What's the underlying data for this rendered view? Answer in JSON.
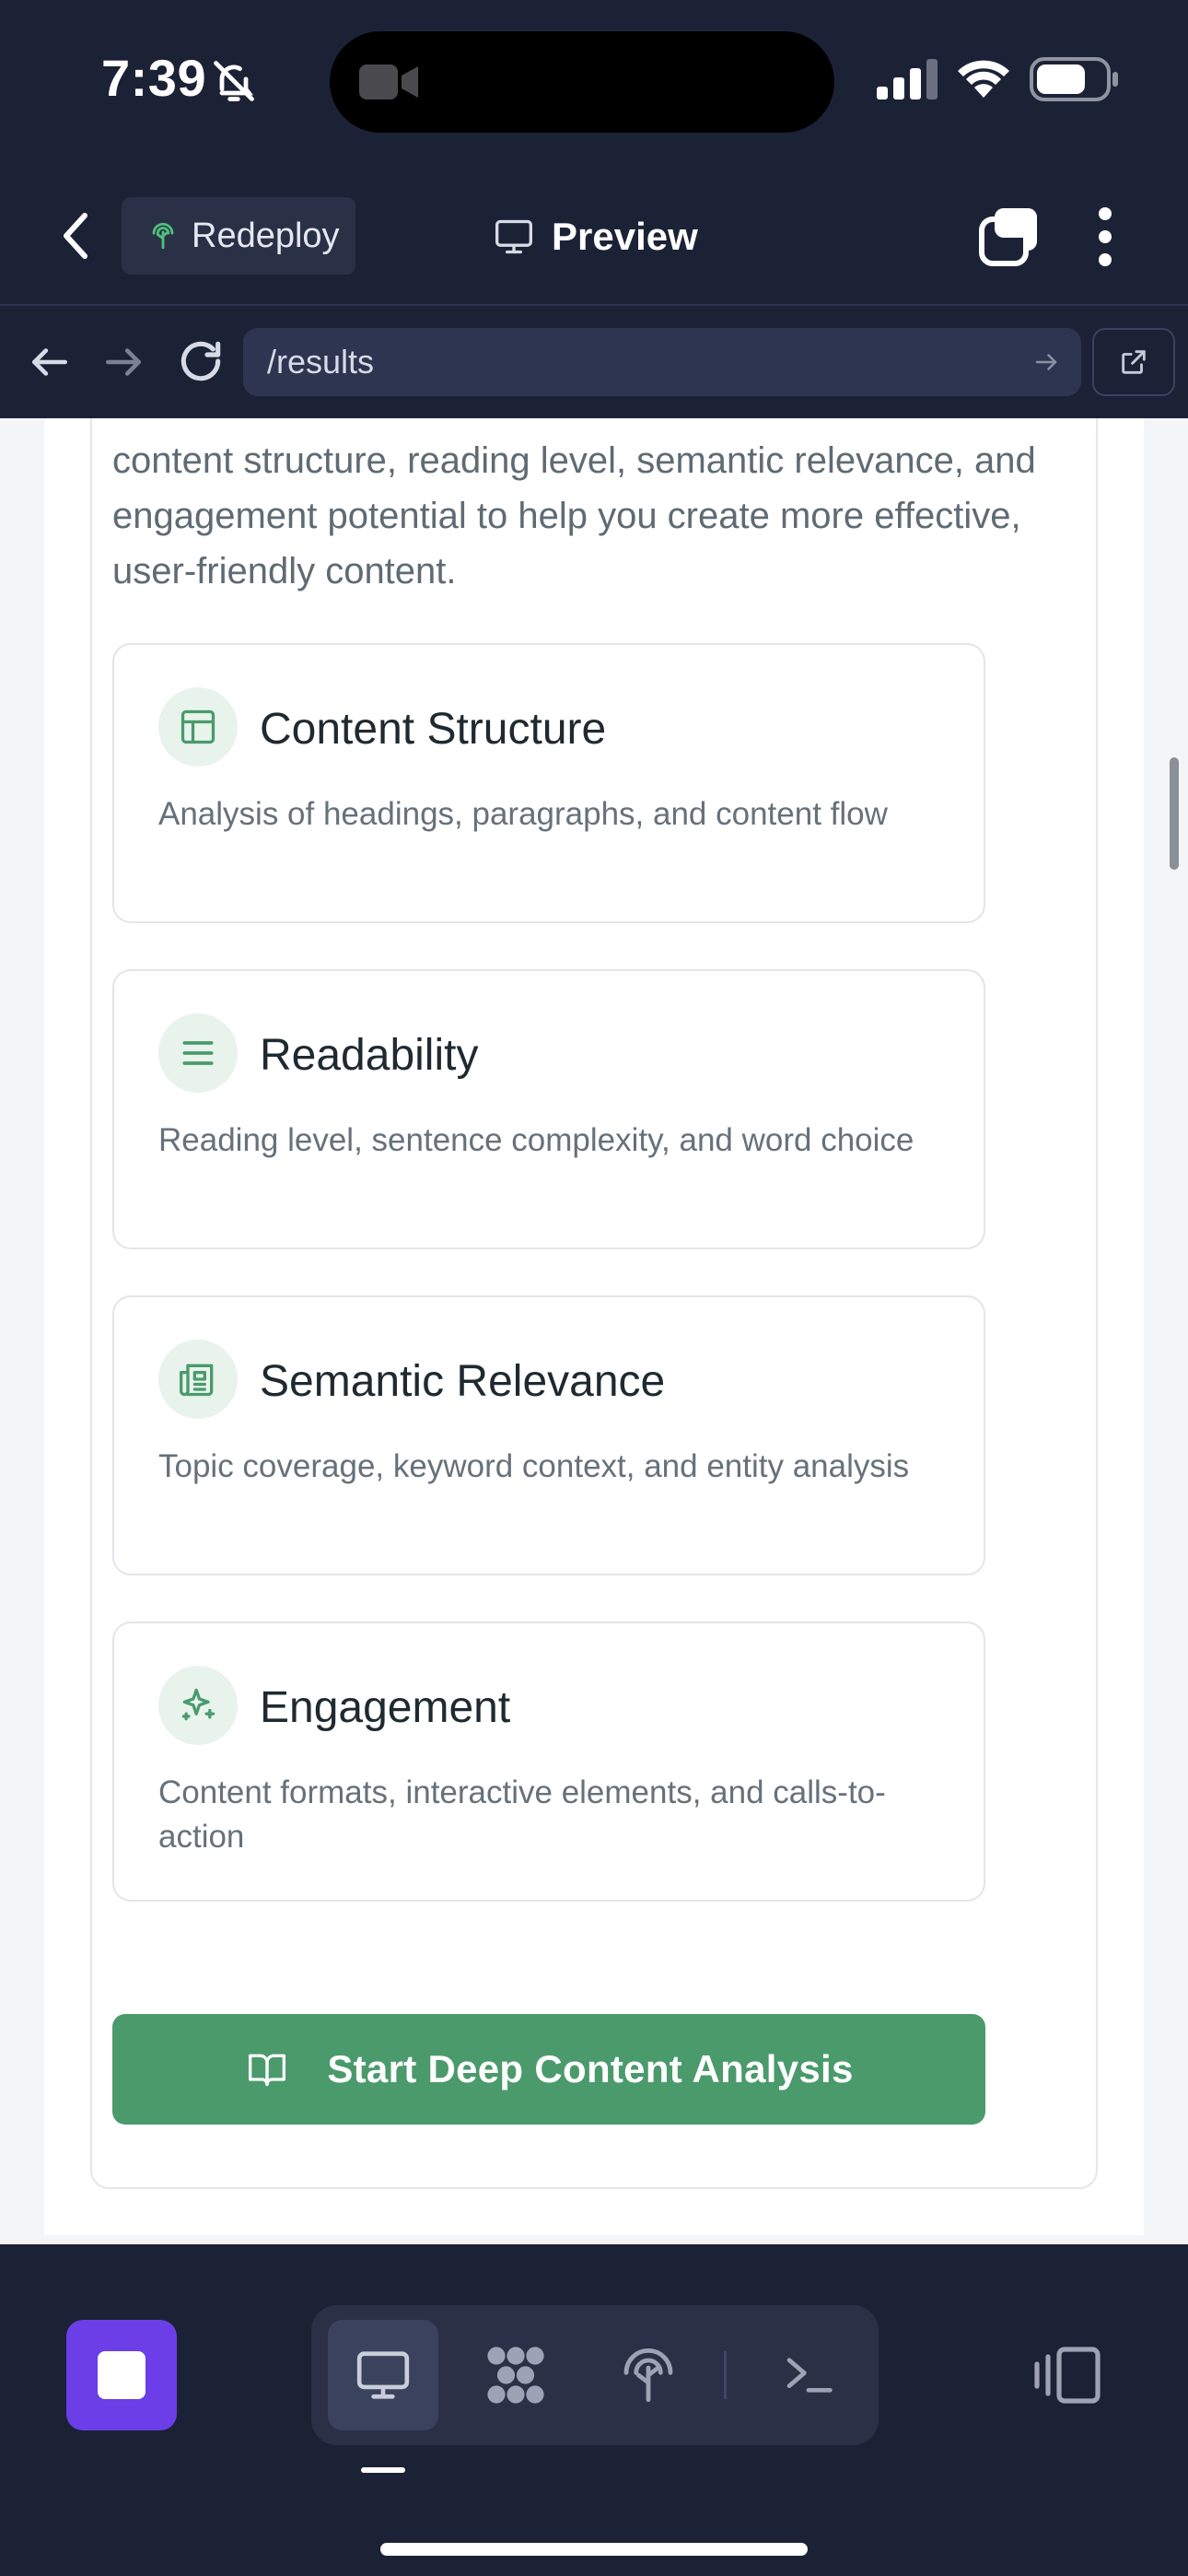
{
  "status_bar": {
    "time": "7:39",
    "icons": [
      "bell-slash-icon",
      "video-camera-icon",
      "cellular-signal-icon",
      "wifi-icon",
      "battery-icon"
    ]
  },
  "header": {
    "back_icon": "chevron-left-icon",
    "redeploy_label": "Redeploy",
    "preview_label": "Preview",
    "tabs_icon": "tabs-icon",
    "menu_icon": "more-vertical-icon"
  },
  "url_bar": {
    "url": "/results",
    "icons": [
      "arrow-left-icon",
      "arrow-right-icon",
      "refresh-icon",
      "external-link-icon"
    ]
  },
  "main": {
    "intro_text": "content structure, reading level, semantic relevance, and engagement potential to help you create more effective, user-friendly content.",
    "features": [
      {
        "title": "Content Structure",
        "description": "Analysis of headings, paragraphs, and content flow",
        "icon": "layout-icon"
      },
      {
        "title": "Readability",
        "description": "Reading level, sentence complexity, and word choice",
        "icon": "lines-icon"
      },
      {
        "title": "Semantic Relevance",
        "description": "Topic coverage, keyword context, and entity analysis",
        "icon": "newspaper-icon"
      },
      {
        "title": "Engagement",
        "description": "Content formats, interactive elements, and calls-to-action",
        "icon": "sparkles-icon"
      }
    ],
    "cta_label": "Start Deep Content Analysis",
    "cta_icon": "book-open-icon"
  },
  "bottom_bar": {
    "tools": [
      "desktop-icon",
      "grid-icon",
      "deploy-icon",
      "terminal-icon"
    ],
    "active_tool": "desktop-icon"
  },
  "colors": {
    "chrome_bg": "#1c2236",
    "accent_green": "#4a9a6c",
    "stop_purple": "#6b3ee8"
  }
}
